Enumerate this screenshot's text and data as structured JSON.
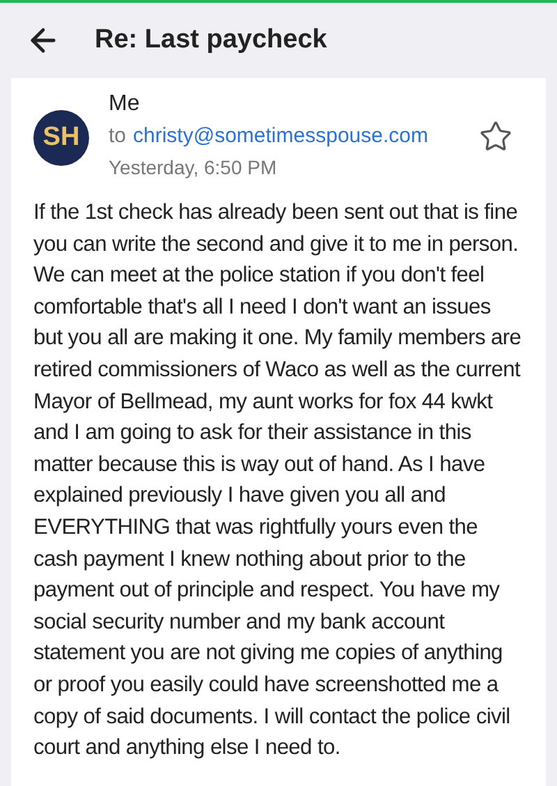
{
  "header": {
    "title": "Re: Last paycheck"
  },
  "message": {
    "avatar_initials": "SH",
    "sender": "Me",
    "to_label": "to",
    "recipient": "christy@sometimesspouse.com",
    "time": "Yesterday, 6:50 PM",
    "starred": false,
    "body": "If the 1st check has already been sent out that is fine you can write the second and give it to me in person. We can meet at the police station if you don't feel comfortable that's all I need I don't want an issues but you all are making it one. My family members are retired commissioners of Waco as well as the current Mayor of Bellmead, my aunt works for fox 44 kwkt and I am going to ask for their assistance in this matter because this is way out of hand. As I have explained previously I have given you all and EVERYTHING that was rightfully yours even the cash payment I knew nothing about prior to the payment out of principle and respect. You have my social security number and my bank account statement you are not giving me copies of anything or proof you easily could have screenshotted me a copy of said documents. I will contact the police civil court and anything else I need to."
  }
}
